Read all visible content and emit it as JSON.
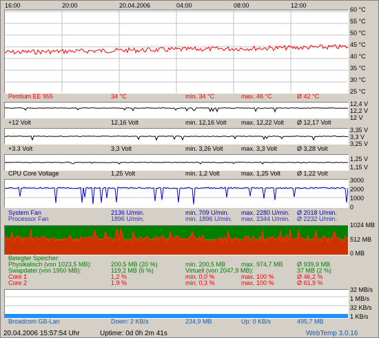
{
  "top_axis": {
    "labels": [
      "16:00",
      "20:00",
      "20.04.2006",
      "04:00",
      "08:00",
      "12:00"
    ]
  },
  "temp_panel": {
    "y_labels": [
      "60 °C",
      "55 °C",
      "50 °C",
      "45 °C",
      "40 °C",
      "35 °C",
      "30 °C",
      "25 °C"
    ],
    "sensor": "Pentium EE 955",
    "current": "34 °C",
    "min": "min. 34 °C",
    "max": "max. 46 °C",
    "avg": "Ø 42 °C",
    "color": "#ff0000"
  },
  "v12_panel": {
    "y_labels": [
      "12,4 V",
      "12,2 V",
      "12 V"
    ],
    "sensor": "+12 Volt",
    "current": "12,16 Volt",
    "min": "min. 12,16 Volt",
    "max": "max. 12,22 Volt",
    "avg": "Ø 12,17 Volt"
  },
  "v33_panel": {
    "y_labels": [
      "3,35 V",
      "3,3 V",
      "3,25 V"
    ],
    "sensor": "+3.3 Volt",
    "current": "3,3 Volt",
    "min": "min. 3,26 Volt",
    "max": "max. 3,3 Volt",
    "avg": "Ø 3,28 Volt"
  },
  "vcore_panel": {
    "y_labels": [
      "1,25 V",
      "1,15 V"
    ],
    "sensor": "CPU Core Voltage",
    "current": "1,25 Volt",
    "min": "min. 1,2 Volt",
    "max": "max. 1,25 Volt",
    "avg": "Ø 1,22 Volt"
  },
  "fan_panel": {
    "y_labels": [
      "3000",
      "2000",
      "1000",
      "0"
    ],
    "rows": [
      {
        "name": "System Fan",
        "current": "2136 U/min.",
        "min": "min. 709 U/min.",
        "max": "max. 2280 U/min.",
        "avg": "Ø 2018 U/min."
      },
      {
        "name": "Processor Fan",
        "current": "1896 U/min.",
        "min": "min. 1896 U/min.",
        "max": "max. 2344 U/min.",
        "avg": "Ø 2232 U/min."
      }
    ],
    "color": "#0000cc"
  },
  "mem_panel": {
    "y_labels": [
      "1024 MB",
      "512 MB",
      "0 MB"
    ],
    "heading": "Belegter Speicher:",
    "rows": [
      {
        "name": "Physikalisch (von 1023,5 MB):",
        "current": "200,5 MB (20 %)",
        "min": "min. 200,5 MB",
        "max": "max. 974,7 MB",
        "avg": "Ø 939,9 MB",
        "cls": "grn"
      },
      {
        "name": "Swapdatei (von 1950 MB):",
        "current": "119,2 MB (6 %)",
        "min": "Virtuell (von 2047,9 MB):",
        "max": "",
        "avg": "37 MB (2 %)",
        "cls": "grn"
      },
      {
        "name": "Core 1",
        "current": "1,2 %",
        "min": "min. 0,0 %",
        "max": "max. 100 %",
        "avg": "Ø 46,2 %",
        "cls": "red"
      },
      {
        "name": "Core 2",
        "current": "1,9 %",
        "min": "min. 0,3 %",
        "max": "max. 100 %",
        "avg": "Ø 61,9 %",
        "cls": "red"
      }
    ]
  },
  "net_panel": {
    "y_labels": [
      "32 MB/s",
      "1 MB/s",
      "32 KB/s",
      "1 KB/s"
    ],
    "name": "Broadcom GB-Lan",
    "down": "Down: 2 KB/s",
    "down_total": "234,9 MB",
    "up": "Up: 0 KB/s",
    "up_total": "495,7 MB"
  },
  "status": {
    "datetime": "20.04.2006 15:57:54 Uhr",
    "uptime": "Uptime: 0d 0h 2m 41s",
    "app": "WebTemp 3.0.16"
  }
}
